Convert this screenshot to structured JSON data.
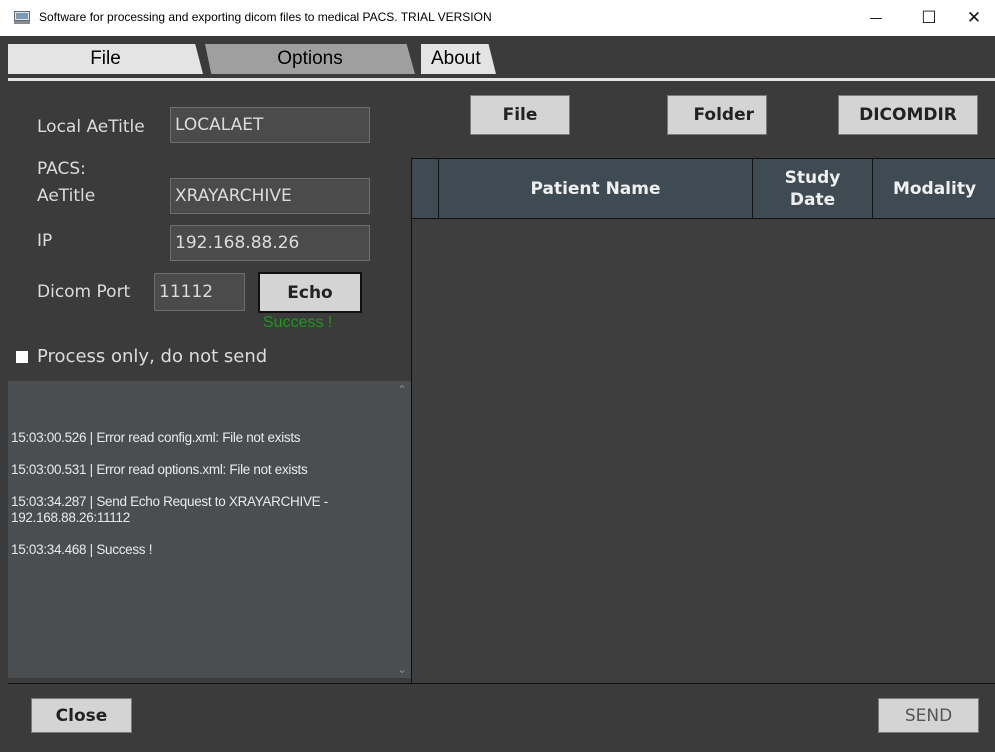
{
  "window": {
    "title": "Software for processing and exporting dicom files to medical PACS. TRIAL VERSION",
    "minimize_glyph": "—",
    "maximize_glyph": "☐",
    "close_glyph": "✕"
  },
  "tabs": [
    {
      "label": "File",
      "active": true
    },
    {
      "label": "Options",
      "active": false
    },
    {
      "label": "About",
      "active": false
    }
  ],
  "settings": {
    "local_aetitle_label": "Local AeTitle",
    "local_aetitle_value": "LOCALAET",
    "pacs_label": "PACS:",
    "aetitle_label": "AeTitle",
    "aetitle_value": "XRAYARCHIVE",
    "ip_label": "IP",
    "ip_value": "192.168.88.26",
    "port_label": "Dicom Port",
    "port_value": "11112",
    "echo_label": "Echo",
    "echo_status": "Success !",
    "process_only_label": "Process only, do not send",
    "process_only_checked": false
  },
  "log": [
    "15:03:00.526 | Error read config.xml: File not exists",
    "15:03:00.531 | Error read options.xml: File not exists",
    "15:03:34.287 | Send Echo Request to XRAYARCHIVE - 192.168.88.26:11112",
    "15:03:34.468 | Success !"
  ],
  "toolbar": {
    "file_label": "File",
    "folder_label": "Folder",
    "dicomdir_label": "DICOMDIR"
  },
  "table": {
    "columns": [
      "",
      "Patient Name",
      "Study Date",
      "Modality"
    ],
    "rows": []
  },
  "footer": {
    "close_label": "Close",
    "send_label": "SEND"
  },
  "colors": {
    "background": "#3b3b3b",
    "header": "#3f4b53",
    "success": "#1a9a1a",
    "button": "#d4d4d4"
  }
}
